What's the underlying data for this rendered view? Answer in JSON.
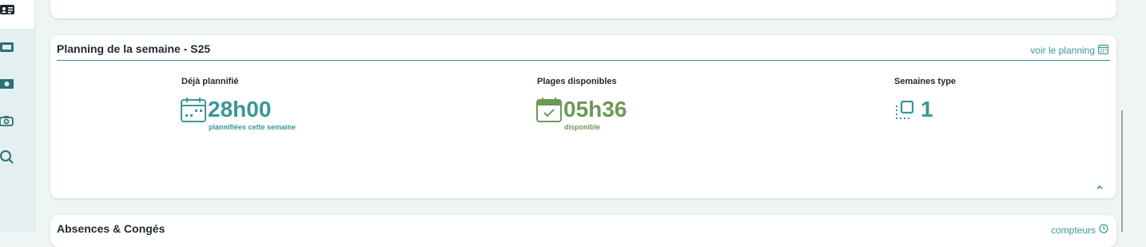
{
  "sidebar": {
    "items": [
      {
        "icon": "id-card-icon",
        "active": true
      },
      {
        "icon": "ticket-icon",
        "active": false
      },
      {
        "icon": "money-icon",
        "active": false
      },
      {
        "icon": "camera-icon",
        "active": false
      },
      {
        "icon": "search-icon",
        "active": false
      }
    ]
  },
  "planning": {
    "title": "Planning de la semaine - S25",
    "link_label": "voir le planning",
    "link_icon": "calendar-icon",
    "stats": [
      {
        "label": "Déjà plannifié",
        "value": "28h00",
        "sub": "plannifiées cette semaine",
        "icon": "calendar-dots-icon",
        "color": "#3a9797"
      },
      {
        "label": "Plages disponibles",
        "value": "05h36",
        "sub": "disponible",
        "icon": "calendar-check-icon",
        "color": "#6c9a56"
      },
      {
        "label": "Semaines type",
        "value": "1",
        "icon": "copy-square-icon",
        "color": "#3a9797"
      }
    ],
    "collapse_icon": "chevron-up-icon"
  },
  "absences": {
    "title": "Absences & Congés",
    "link_label": "compteurs",
    "link_icon": "clock-icon"
  }
}
